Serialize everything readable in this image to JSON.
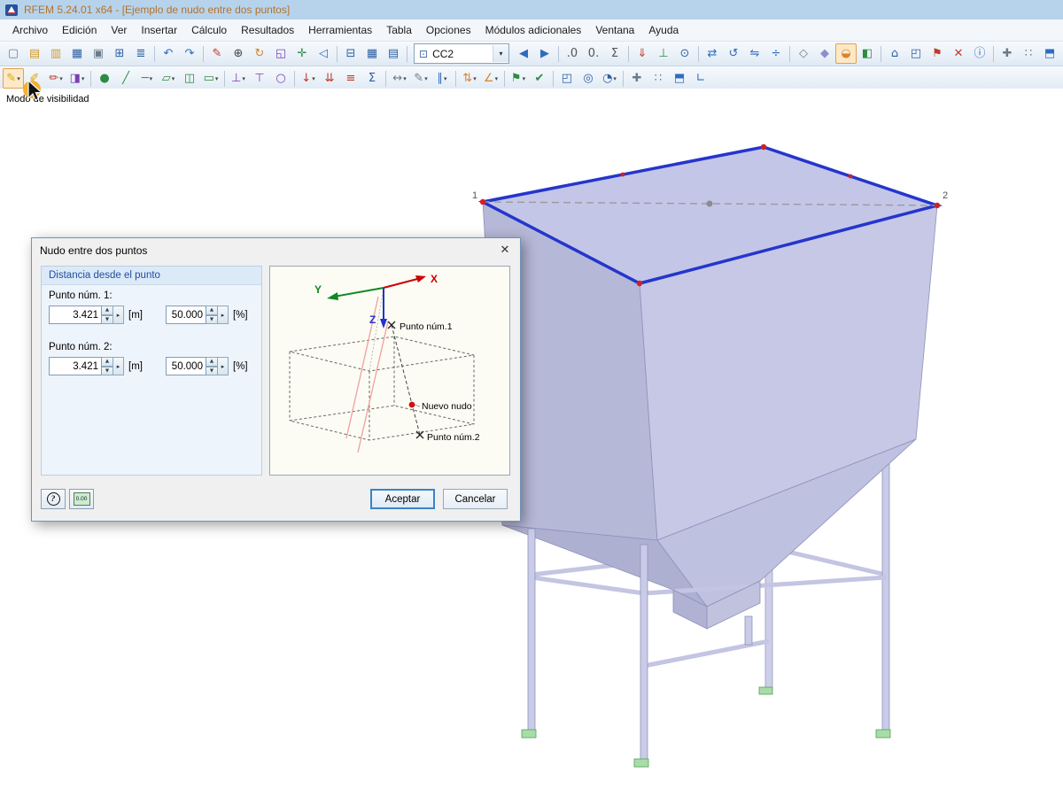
{
  "window": {
    "title": "RFEM 5.24.01 x64 - [Ejemplo de nudo entre dos puntos]"
  },
  "menubar": {
    "items": [
      {
        "name": "menu-archivo",
        "label": "Archivo"
      },
      {
        "name": "menu-edicion",
        "label": "Edición"
      },
      {
        "name": "menu-ver",
        "label": "Ver"
      },
      {
        "name": "menu-insertar",
        "label": "Insertar"
      },
      {
        "name": "menu-calculo",
        "label": "Cálculo"
      },
      {
        "name": "menu-resultados",
        "label": "Resultados"
      },
      {
        "name": "menu-herramientas",
        "label": "Herramientas"
      },
      {
        "name": "menu-tabla",
        "label": "Tabla"
      },
      {
        "name": "menu-opciones",
        "label": "Opciones"
      },
      {
        "name": "menu-modulos-adicionales",
        "label": "Módulos adicionales"
      },
      {
        "name": "menu-ventana",
        "label": "Ventana"
      },
      {
        "name": "menu-ayuda",
        "label": "Ayuda"
      }
    ]
  },
  "toolbar_main": {
    "combo": {
      "icon": "⊡",
      "value": "CC2"
    },
    "left": [
      {
        "name": "new-file-icon",
        "glyph": "▢",
        "color": "#6b7b8c"
      },
      {
        "name": "open-file-icon",
        "glyph": "▤",
        "color": "#cf9a2f"
      },
      {
        "name": "open-project-icon",
        "glyph": "▥",
        "color": "#cf9a2f"
      },
      {
        "name": "save-icon",
        "glyph": "▦",
        "color": "#2e5fa3"
      },
      {
        "name": "print-icon",
        "glyph": "▣",
        "color": "#6b7b8c"
      },
      {
        "name": "copy-picture-icon",
        "glyph": "⊞",
        "color": "#2e5fa3"
      },
      {
        "name": "printout-report-icon",
        "glyph": "≣",
        "color": "#2e5fa3"
      },
      {
        "sep": true
      },
      {
        "name": "undo-icon",
        "glyph": "↶",
        "color": "#2e6cc0"
      },
      {
        "name": "redo-icon",
        "glyph": "↷",
        "color": "#2e6cc0"
      },
      {
        "sep": true
      },
      {
        "name": "new-comment-icon",
        "glyph": "✎",
        "color": "#c0392b"
      },
      {
        "name": "zoom-in-icon",
        "glyph": "⊕",
        "color": "#444444"
      },
      {
        "name": "rotate-view-icon",
        "glyph": "↻",
        "color": "#d9832b"
      },
      {
        "name": "zoom-window-icon",
        "glyph": "◱",
        "color": "#7b3fb5"
      },
      {
        "name": "pan-view-icon",
        "glyph": "✛",
        "color": "#2e8b44"
      },
      {
        "name": "previous-view-icon",
        "glyph": "◁",
        "color": "#2e6cc0"
      },
      {
        "sep": true
      },
      {
        "name": "table-layout-icon",
        "glyph": "⊟",
        "color": "#2e5fa3"
      },
      {
        "name": "table-view-icon",
        "glyph": "▦",
        "color": "#2e5fa3"
      },
      {
        "name": "table-settings-icon",
        "glyph": "▤",
        "color": "#2e5fa3"
      },
      {
        "sep": true
      }
    ],
    "right": [
      {
        "name": "previous-load-case-icon",
        "glyph": "◀",
        "color": "#2e6cc0"
      },
      {
        "name": "next-load-case-icon",
        "glyph": "▶",
        "color": "#2e6cc0"
      },
      {
        "sep": true
      },
      {
        "name": "decimal-increase-icon",
        "glyph": ".0",
        "color": "#555555"
      },
      {
        "name": "decimal-decrease-icon",
        "glyph": "0.",
        "color": "#555555"
      },
      {
        "name": "units-icon",
        "glyph": "Σ",
        "color": "#555555"
      },
      {
        "sep": true
      },
      {
        "name": "show-loads-icon",
        "glyph": "⇓",
        "color": "#c0392b"
      },
      {
        "name": "show-supports-icon",
        "glyph": "⊥",
        "color": "#2e8b44"
      },
      {
        "name": "show-numbering-icon",
        "glyph": "⊙",
        "color": "#2e5fa3"
      },
      {
        "sep": true
      },
      {
        "name": "move-copy-icon",
        "glyph": "⇄",
        "color": "#2e6cc0"
      },
      {
        "name": "rotate-objects-icon",
        "glyph": "↺",
        "color": "#2e6cc0"
      },
      {
        "name": "mirror-objects-icon",
        "glyph": "⇋",
        "color": "#2e6cc0"
      },
      {
        "name": "divide-lines-icon",
        "glyph": "÷",
        "color": "#2e6cc0"
      },
      {
        "sep": true
      },
      {
        "name": "wireframe-display-icon",
        "glyph": "◇",
        "color": "#6b7b8c"
      },
      {
        "name": "solid-display-icon",
        "glyph": "◆",
        "color": "#8a8fd0"
      },
      {
        "name": "visibility-filter-icon",
        "glyph": "◒",
        "color": "#d9832b",
        "hot": true
      },
      {
        "name": "clipping-plane-icon",
        "glyph": "◧",
        "color": "#2e8b44"
      },
      {
        "sep": true
      },
      {
        "name": "isometric-view-icon",
        "glyph": "⌂",
        "color": "#2e5fa3"
      },
      {
        "name": "view-in-x-icon",
        "glyph": "◰",
        "color": "#2e5fa3"
      },
      {
        "name": "flag-icon",
        "glyph": "⚑",
        "color": "#c0392b"
      },
      {
        "name": "delete-results-icon",
        "glyph": "✕",
        "color": "#c0392b"
      },
      {
        "name": "info-icon",
        "glyph": "ⓘ",
        "color": "#2e5fa3"
      },
      {
        "sep": true
      },
      {
        "name": "snap-settings-icon",
        "glyph": "✚",
        "color": "#6b7b8c"
      },
      {
        "name": "grid-settings-icon",
        "glyph": "∷",
        "color": "#6b7b8c"
      },
      {
        "name": "work-plane-icon",
        "glyph": "⬒",
        "color": "#2e6cc0"
      }
    ]
  },
  "toolbar_secondary": {
    "icons": [
      {
        "name": "visibility-mode-icon",
        "glyph": "✎",
        "color": "#d9a40f",
        "caret": true,
        "hot": true
      },
      {
        "name": "visibility-by-window-icon",
        "glyph": "✐",
        "color": "#d9a40f"
      },
      {
        "name": "special-selection-icon",
        "glyph": "✏",
        "color": "#c0392b",
        "caret": true
      },
      {
        "name": "partial-view-icon",
        "glyph": "◨",
        "color": "#7b3fb5",
        "caret": true
      },
      {
        "sep": true
      },
      {
        "name": "new-node-icon",
        "glyph": "●",
        "color": "#2e8b44"
      },
      {
        "name": "new-line-icon",
        "glyph": "╱",
        "color": "#2e8b44"
      },
      {
        "name": "new-member-icon",
        "glyph": "─",
        "color": "#8a6d3b",
        "caret": true
      },
      {
        "name": "new-surface-icon",
        "glyph": "▱",
        "color": "#2e8b44",
        "caret": true
      },
      {
        "name": "new-solid-icon",
        "glyph": "◫",
        "color": "#2e8b44"
      },
      {
        "name": "new-opening-icon",
        "glyph": "▭",
        "color": "#2e8b44",
        "caret": true
      },
      {
        "sep": true
      },
      {
        "name": "nodal-support-icon",
        "glyph": "⊥",
        "color": "#7b3fb5",
        "caret": true
      },
      {
        "name": "line-support-icon",
        "glyph": "⊤",
        "color": "#7b3fb5"
      },
      {
        "name": "member-hinge-icon",
        "glyph": "○",
        "color": "#7b3fb5"
      },
      {
        "sep": true
      },
      {
        "name": "nodal-load-icon",
        "glyph": "↓",
        "color": "#c0392b",
        "caret": true
      },
      {
        "name": "member-load-icon",
        "glyph": "⇊",
        "color": "#c0392b"
      },
      {
        "name": "surface-load-icon",
        "glyph": "≡",
        "color": "#c0392b"
      },
      {
        "name": "load-combination-icon",
        "glyph": "Σ",
        "color": "#2e5fa3"
      },
      {
        "sep": true
      },
      {
        "name": "dimension-icon",
        "glyph": "↔",
        "color": "#6b7b8c",
        "caret": true
      },
      {
        "name": "comment-tool-icon",
        "glyph": "✎",
        "color": "#6b7b8c",
        "caret": true
      },
      {
        "name": "guideline-icon",
        "glyph": "∥",
        "color": "#2e6cc0",
        "caret": true
      },
      {
        "sep": true
      },
      {
        "name": "renumber-icon",
        "glyph": "⇅",
        "color": "#d9832b",
        "caret": true
      },
      {
        "name": "measure-icon",
        "glyph": "∠",
        "color": "#d9832b",
        "caret": true
      },
      {
        "sep": true
      },
      {
        "name": "generate-model-icon",
        "glyph": "⚑",
        "color": "#2e8b44",
        "caret": true
      },
      {
        "name": "check-model-icon",
        "glyph": "✔",
        "color": "#2e8b44"
      },
      {
        "sep": true
      },
      {
        "name": "view-3d-icon",
        "glyph": "◰",
        "color": "#2e5fa3"
      },
      {
        "name": "zoom-extents-icon",
        "glyph": "◎",
        "color": "#2e5fa3"
      },
      {
        "name": "render-mode-icon",
        "glyph": "◔",
        "color": "#2e5fa3",
        "caret": true
      },
      {
        "sep": true
      },
      {
        "name": "snap-icon",
        "glyph": "✚",
        "color": "#6b7b8c"
      },
      {
        "name": "grid-icon",
        "glyph": "∷",
        "color": "#6b7b8c"
      },
      {
        "name": "work-plane-xy-icon",
        "glyph": "⬒",
        "color": "#2e6cc0"
      },
      {
        "name": "coordinate-system-icon",
        "glyph": "∟",
        "color": "#2e6cc0"
      }
    ]
  },
  "tooltip": {
    "text": "Modo de visibilidad"
  },
  "canvas": {
    "node1_label": "1",
    "node2_label": "2"
  },
  "dialog": {
    "title": "Nudo entre dos puntos",
    "group_title": "Distancia desde el punto",
    "point1": {
      "label": "Punto núm. 1:",
      "distance": "3.421",
      "distance_unit": "[m]",
      "percent": "50.000",
      "percent_unit": "[%]"
    },
    "point2": {
      "label": "Punto núm. 2:",
      "distance": "3.421",
      "distance_unit": "[m]",
      "percent": "50.000",
      "percent_unit": "[%]"
    },
    "diagram": {
      "axis_x": "X",
      "axis_y": "Y",
      "axis_z": "Z",
      "point1_label": "Punto núm.1",
      "new_node_label": "Nuevo nudo",
      "point2_label": "Punto núm.2"
    },
    "calc_display": "0.00",
    "ok_label": "Aceptar",
    "cancel_label": "Cancelar"
  },
  "icons": {
    "close": "✕",
    "spin_up": "▲",
    "spin_down": "▼",
    "expand": "▸",
    "help": "?",
    "combo_arrow": "▾",
    "caret": "▾"
  }
}
